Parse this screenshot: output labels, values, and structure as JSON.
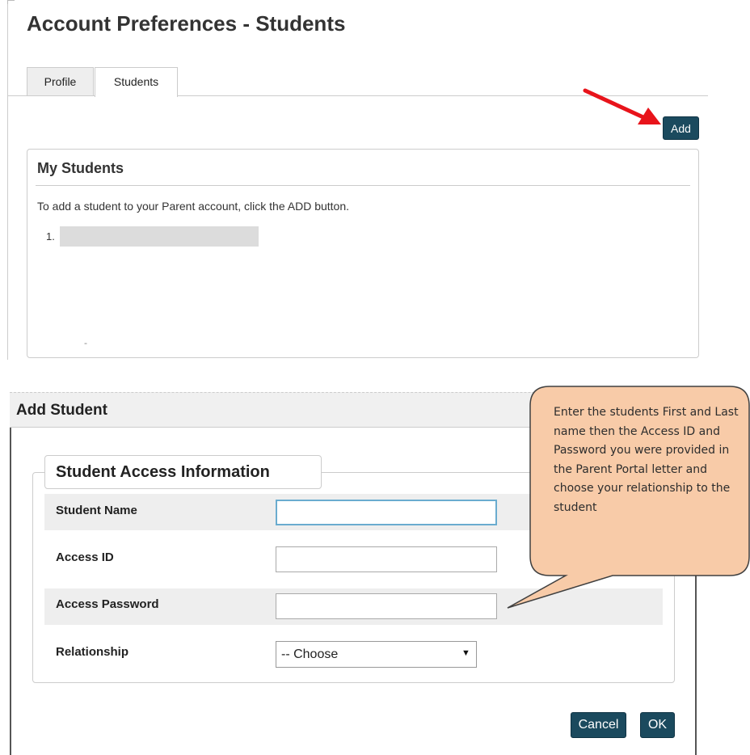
{
  "page": {
    "title": "Account Preferences - Students",
    "tabs": [
      {
        "label": "Profile"
      },
      {
        "label": "Students"
      }
    ],
    "add_label": "Add"
  },
  "my_students": {
    "title": "My Students",
    "instruction": "To add a student to your Parent account, click the ADD button.",
    "list": [
      {
        "number": "1."
      }
    ],
    "dash": "-"
  },
  "dialog": {
    "title": "Add Student",
    "section_title": "Student Access Information",
    "fields": [
      {
        "label": "Student Name",
        "value": ""
      },
      {
        "label": "Access ID",
        "value": ""
      },
      {
        "label": "Access Password",
        "value": ""
      },
      {
        "label": "Relationship",
        "value": "-- Choose"
      }
    ],
    "cancel_label": "Cancel",
    "ok_label": "OK"
  },
  "callout": {
    "text": "Enter the students First and Last name then the Access ID and Password you were provided in the Parent Portal letter and choose your relationship to the student"
  },
  "colors": {
    "button": "#1b4a5e",
    "arrow": "#e8141b",
    "callout_fill": "#f8cba8",
    "callout_border": "#404040",
    "input_focus": "#6aaccf"
  },
  "icons": {
    "arrow": "red-arrow-icon",
    "dropdown": "chevron-down-icon"
  }
}
